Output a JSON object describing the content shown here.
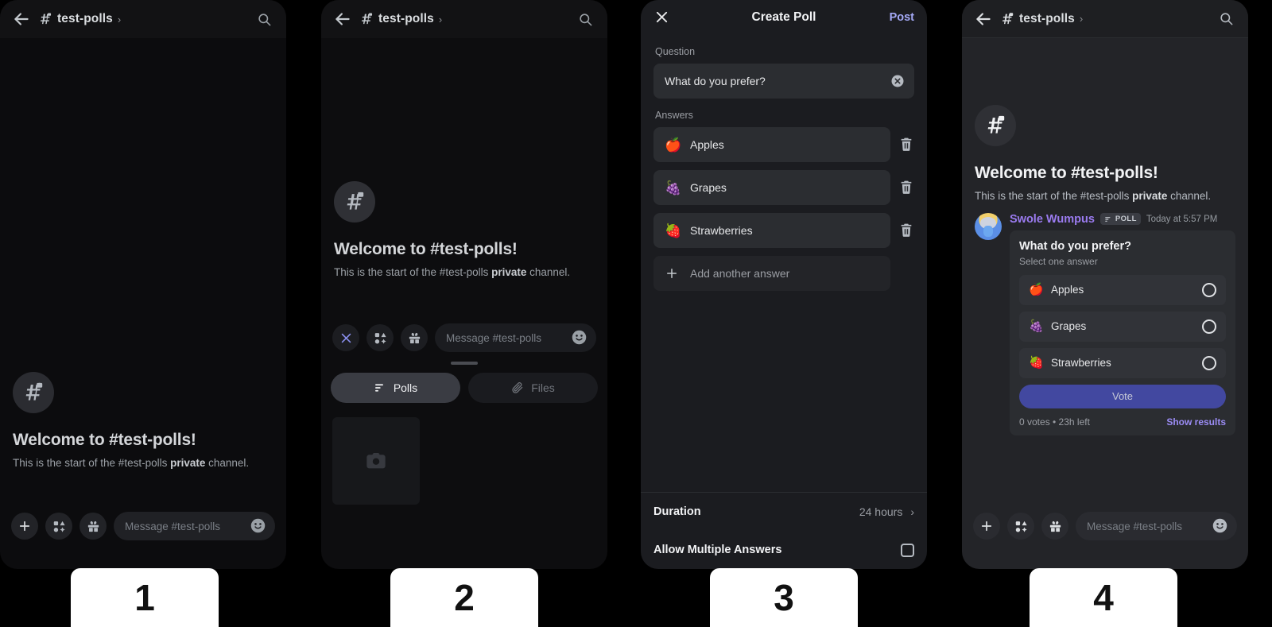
{
  "panels": [
    {
      "number": "1",
      "header": {
        "channel": "test-polls",
        "back_icon": "arrow-left-icon",
        "hash_icon": "hash-lock-icon",
        "chevron": "›",
        "search_icon": "search-icon"
      },
      "welcome": {
        "heading": "Welcome to #test-polls!",
        "body_before": "This is the start of the #test-polls ",
        "body_bold": "private",
        "body_after": " channel."
      },
      "composer": {
        "plus_icon": "plus-icon",
        "apps_icon": "apps-icon",
        "gift_icon": "gift-icon",
        "placeholder": "Message #test-polls",
        "emoji_icon": "emoji-icon"
      }
    },
    {
      "number": "2",
      "header": {
        "channel": "test-polls",
        "back_icon": "arrow-left-icon",
        "hash_icon": "hash-lock-icon",
        "chevron": "›",
        "search_icon": "search-icon"
      },
      "welcome": {
        "heading": "Welcome to #test-polls!",
        "body_before": "This is the start of the #test-polls ",
        "body_bold": "private",
        "body_after": " channel."
      },
      "composer": {
        "close_icon": "close-icon",
        "apps_icon": "apps-icon",
        "gift_icon": "gift-icon",
        "placeholder": "Message #test-polls",
        "emoji_icon": "emoji-icon"
      },
      "tray": {
        "tabs": [
          {
            "label": "Polls",
            "icon": "poll-icon",
            "active": true
          },
          {
            "label": "Files",
            "icon": "paperclip-icon",
            "active": false
          }
        ],
        "thumb_icon": "camera-icon"
      }
    },
    {
      "number": "3",
      "modal": {
        "close_icon": "close-icon",
        "title": "Create Poll",
        "post_label": "Post",
        "question_label": "Question",
        "question_value": "What do you prefer?",
        "clear_icon": "clear-circle-icon",
        "answers_label": "Answers",
        "answers": [
          {
            "emoji": "🍎",
            "text": "Apples",
            "delete_icon": "trash-icon"
          },
          {
            "emoji": "🍇",
            "text": "Grapes",
            "delete_icon": "trash-icon"
          },
          {
            "emoji": "🍓",
            "text": "Strawberries",
            "delete_icon": "trash-icon"
          }
        ],
        "add_answer_label": "Add another answer",
        "add_icon": "plus-icon",
        "duration_label": "Duration",
        "duration_value": "24 hours",
        "duration_chevron": "›",
        "multi_label": "Allow Multiple Answers",
        "multi_checked": false
      }
    },
    {
      "number": "4",
      "header": {
        "channel": "test-polls",
        "back_icon": "arrow-left-icon",
        "hash_icon": "hash-lock-icon",
        "chevron": "›",
        "search_icon": "search-icon"
      },
      "welcome": {
        "heading": "Welcome to #test-polls!",
        "body_before": "This is the start of the #test-polls ",
        "body_bold": "private",
        "body_after": " channel."
      },
      "message": {
        "author": "Swole Wumpus",
        "badge": "POLL",
        "badge_icon": "poll-icon",
        "timestamp": "Today at 5:57 PM",
        "poll": {
          "question": "What do you prefer?",
          "subtitle": "Select one answer",
          "options": [
            {
              "emoji": "🍎",
              "text": "Apples"
            },
            {
              "emoji": "🍇",
              "text": "Grapes"
            },
            {
              "emoji": "🍓",
              "text": "Strawberries"
            }
          ],
          "vote_label": "Vote",
          "votes_text": "0 votes  •  23h left",
          "show_results_label": "Show results"
        }
      },
      "composer": {
        "plus_icon": "plus-icon",
        "apps_icon": "apps-icon",
        "gift_icon": "gift-icon",
        "placeholder": "Message #test-polls",
        "emoji_icon": "emoji-icon"
      }
    }
  ],
  "colors": {
    "accent_post": "#a4a9f6",
    "vote_button": "#4248a0",
    "author": "#9b7bf0",
    "show_results": "#9b8cf5",
    "label_bg": "#ffffff"
  }
}
